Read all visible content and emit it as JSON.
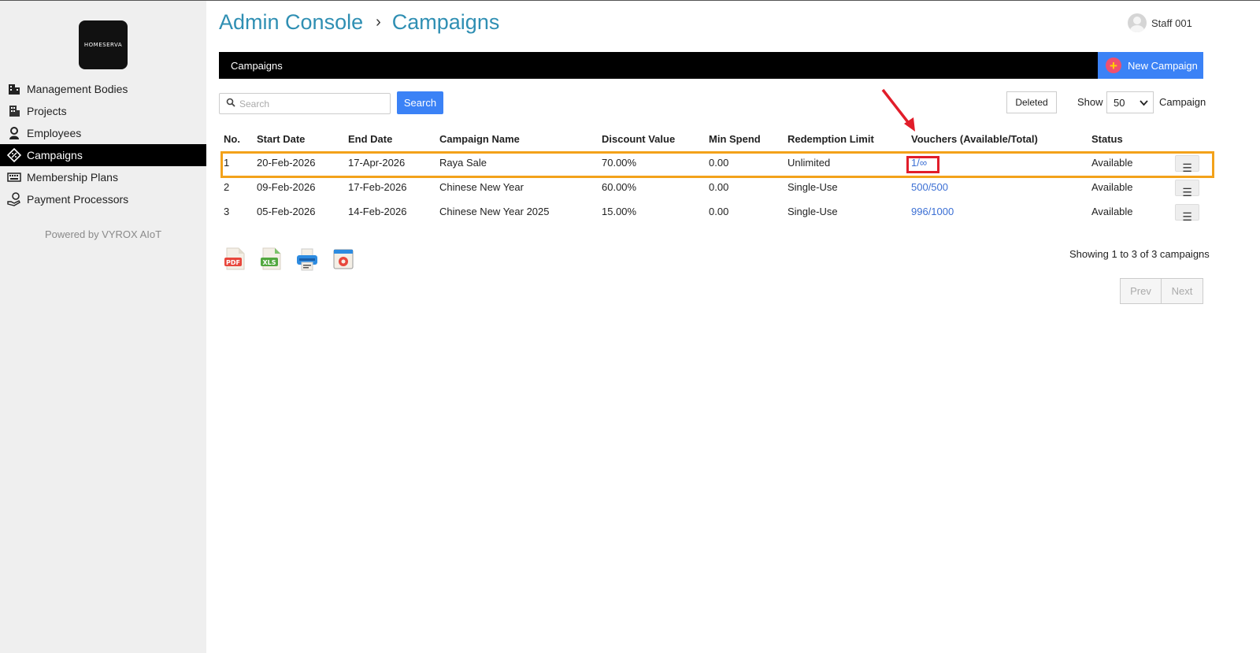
{
  "sidebar": {
    "logo_text": "HOMESERVA",
    "items": [
      {
        "label": "Management Bodies",
        "icon": "building-icon"
      },
      {
        "label": "Projects",
        "icon": "office-icon"
      },
      {
        "label": "Employees",
        "icon": "person-icon"
      },
      {
        "label": "Campaigns",
        "icon": "tag-icon",
        "active": true
      },
      {
        "label": "Membership Plans",
        "icon": "keyboard-icon"
      },
      {
        "label": "Payment Processors",
        "icon": "hand-coin-icon"
      }
    ],
    "powered_by": "Powered by VYROX AIoT"
  },
  "header": {
    "breadcrumb_root": "Admin Console",
    "breadcrumb_sep": "›",
    "breadcrumb_current": "Campaigns",
    "user_name": "Staff 001"
  },
  "toolbar": {
    "title": "Campaigns",
    "new_button": "New Campaign",
    "search_placeholder": "Search",
    "search_button": "Search",
    "deleted_button": "Deleted",
    "show_label": "Show",
    "show_value": "50",
    "show_suffix": "Campaign"
  },
  "table": {
    "columns": [
      "No.",
      "Start Date",
      "End Date",
      "Campaign Name",
      "Discount Value",
      "Min Spend",
      "Redemption Limit",
      "Vouchers (Available/Total)",
      "Status"
    ],
    "rows": [
      {
        "no": "1",
        "start": "20-Feb-2026",
        "end": "17-Apr-2026",
        "name": "Raya Sale",
        "discount": "70.00%",
        "min_spend": "0.00",
        "limit": "Unlimited",
        "vouchers": "1/∞",
        "status": "Available"
      },
      {
        "no": "2",
        "start": "09-Feb-2026",
        "end": "17-Feb-2026",
        "name": "Chinese New Year",
        "discount": "60.00%",
        "min_spend": "0.00",
        "limit": "Single-Use",
        "vouchers": "500/500",
        "status": "Available"
      },
      {
        "no": "3",
        "start": "05-Feb-2026",
        "end": "14-Feb-2026",
        "name": "Chinese New Year 2025",
        "discount": "15.00%",
        "min_spend": "0.00",
        "limit": "Single-Use",
        "vouchers": "996/1000",
        "status": "Available"
      }
    ],
    "row_menu_glyph": "☰"
  },
  "exports": {
    "pdf_label": "PDF",
    "xls_label": "XLS"
  },
  "footer": {
    "showing": "Showing 1 to 3 of 3 campaigns",
    "prev": "Prev",
    "next": "Next"
  },
  "colors": {
    "accent_blue": "#3b82f6",
    "breadcrumb": "#2f8fb3",
    "highlight_row": "#f3a21a",
    "highlight_cell": "#e11d2a"
  }
}
